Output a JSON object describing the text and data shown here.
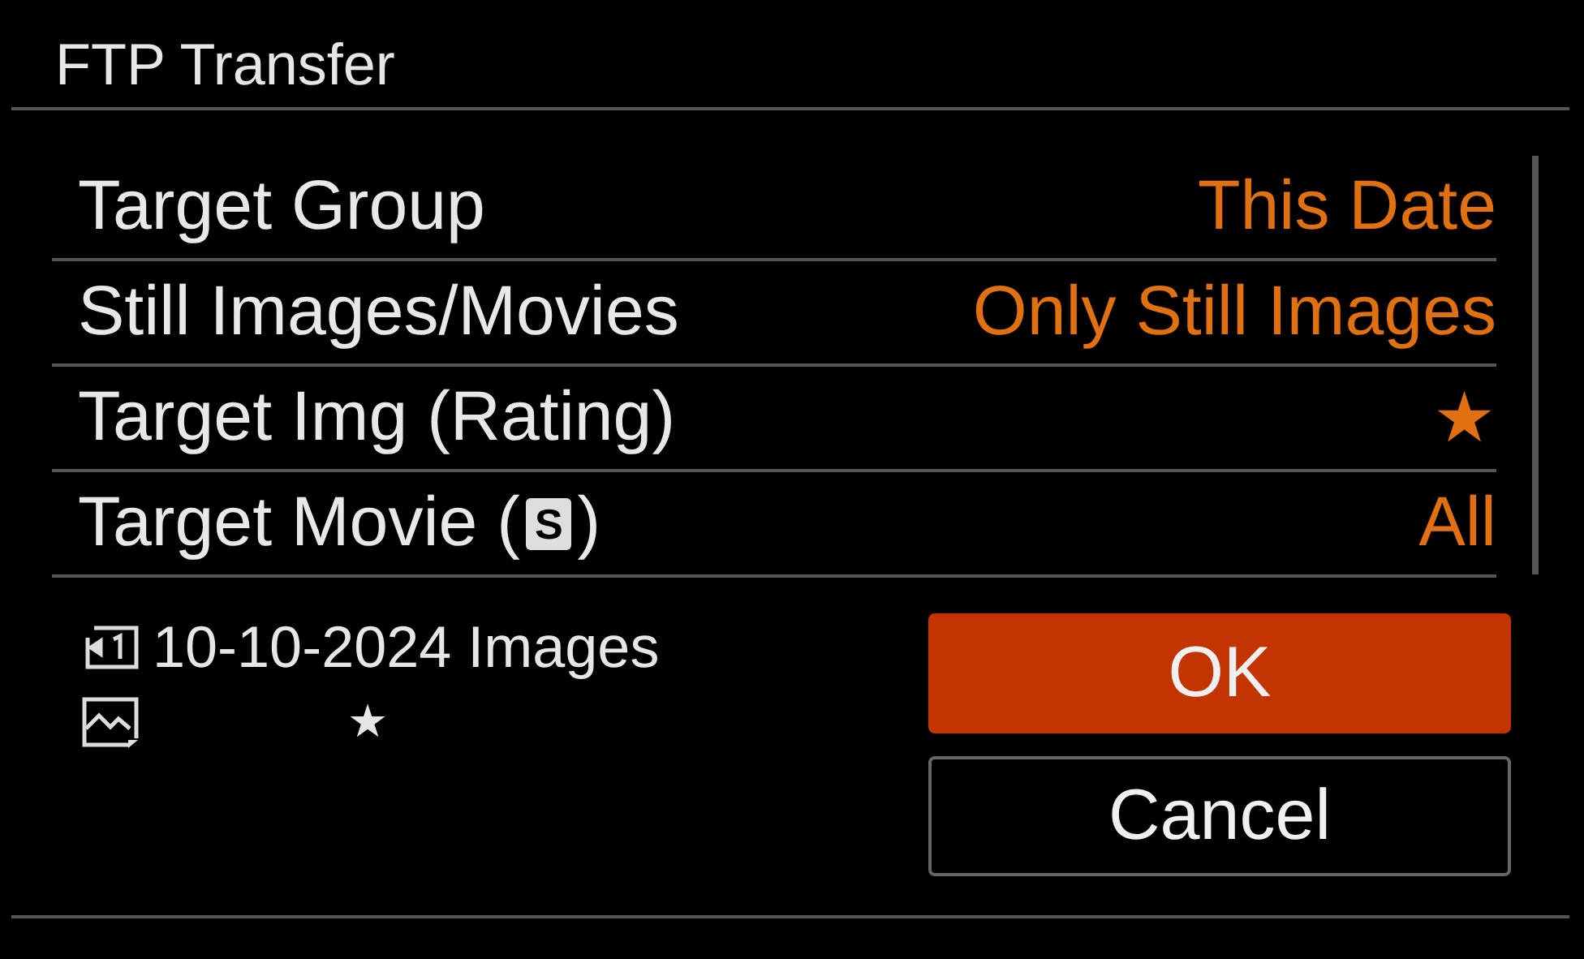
{
  "title": "FTP Transfer",
  "settings": [
    {
      "label": "Target Group",
      "value": "This Date"
    },
    {
      "label": "Still Images/Movies",
      "value": "Only Still Images"
    },
    {
      "label": "Target Img (Rating)",
      "value": "★"
    },
    {
      "label": "Target Movie (",
      "badge": "S",
      "label_end": ")",
      "value": "All"
    }
  ],
  "summary": {
    "target": "10-10-2024 Images",
    "rating": "★"
  },
  "buttons": [
    {
      "label": "OK",
      "selected": true
    },
    {
      "label": "Cancel",
      "selected": false
    }
  ]
}
